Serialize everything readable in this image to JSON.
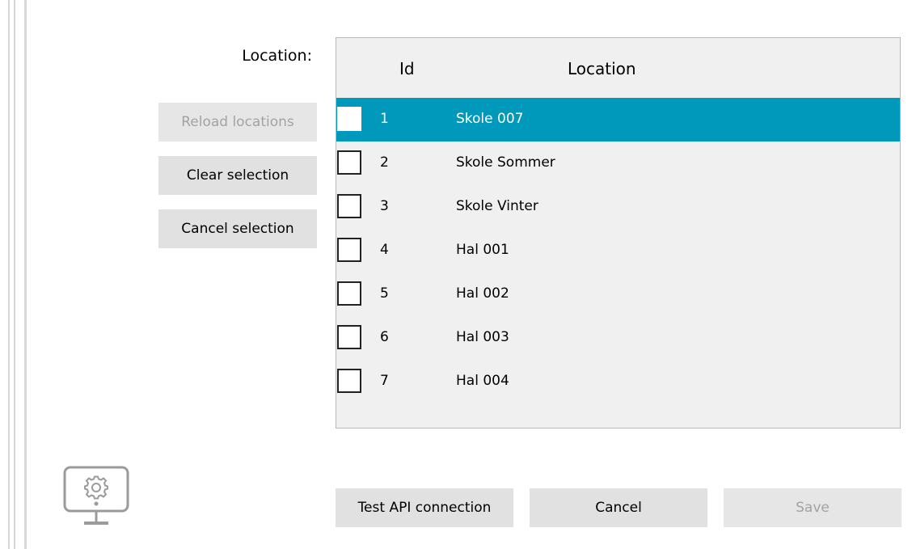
{
  "form": {
    "location_label": "Location:"
  },
  "side_buttons": {
    "reload": "Reload locations",
    "clear": "Clear selection",
    "cancel_selection": "Cancel selection"
  },
  "grid": {
    "columns": {
      "id": "Id",
      "location": "Location"
    },
    "rows": [
      {
        "id": "1",
        "location": "Skole 007",
        "selected": true,
        "checked": false
      },
      {
        "id": "2",
        "location": "Skole Sommer",
        "selected": false,
        "checked": false
      },
      {
        "id": "3",
        "location": "Skole Vinter",
        "selected": false,
        "checked": false
      },
      {
        "id": "4",
        "location": "Hal 001",
        "selected": false,
        "checked": false
      },
      {
        "id": "5",
        "location": "Hal 002",
        "selected": false,
        "checked": false
      },
      {
        "id": "6",
        "location": "Hal 003",
        "selected": false,
        "checked": false
      },
      {
        "id": "7",
        "location": "Hal 004",
        "selected": false,
        "checked": false
      }
    ]
  },
  "footer": {
    "test_api": "Test API connection",
    "cancel": "Cancel",
    "save": "Save"
  },
  "icons": {
    "settings": "monitor-gear-icon"
  },
  "colors": {
    "selection": "#0099bc",
    "button": "#e1e1e1",
    "disabled_text": "#a3a3a3"
  }
}
